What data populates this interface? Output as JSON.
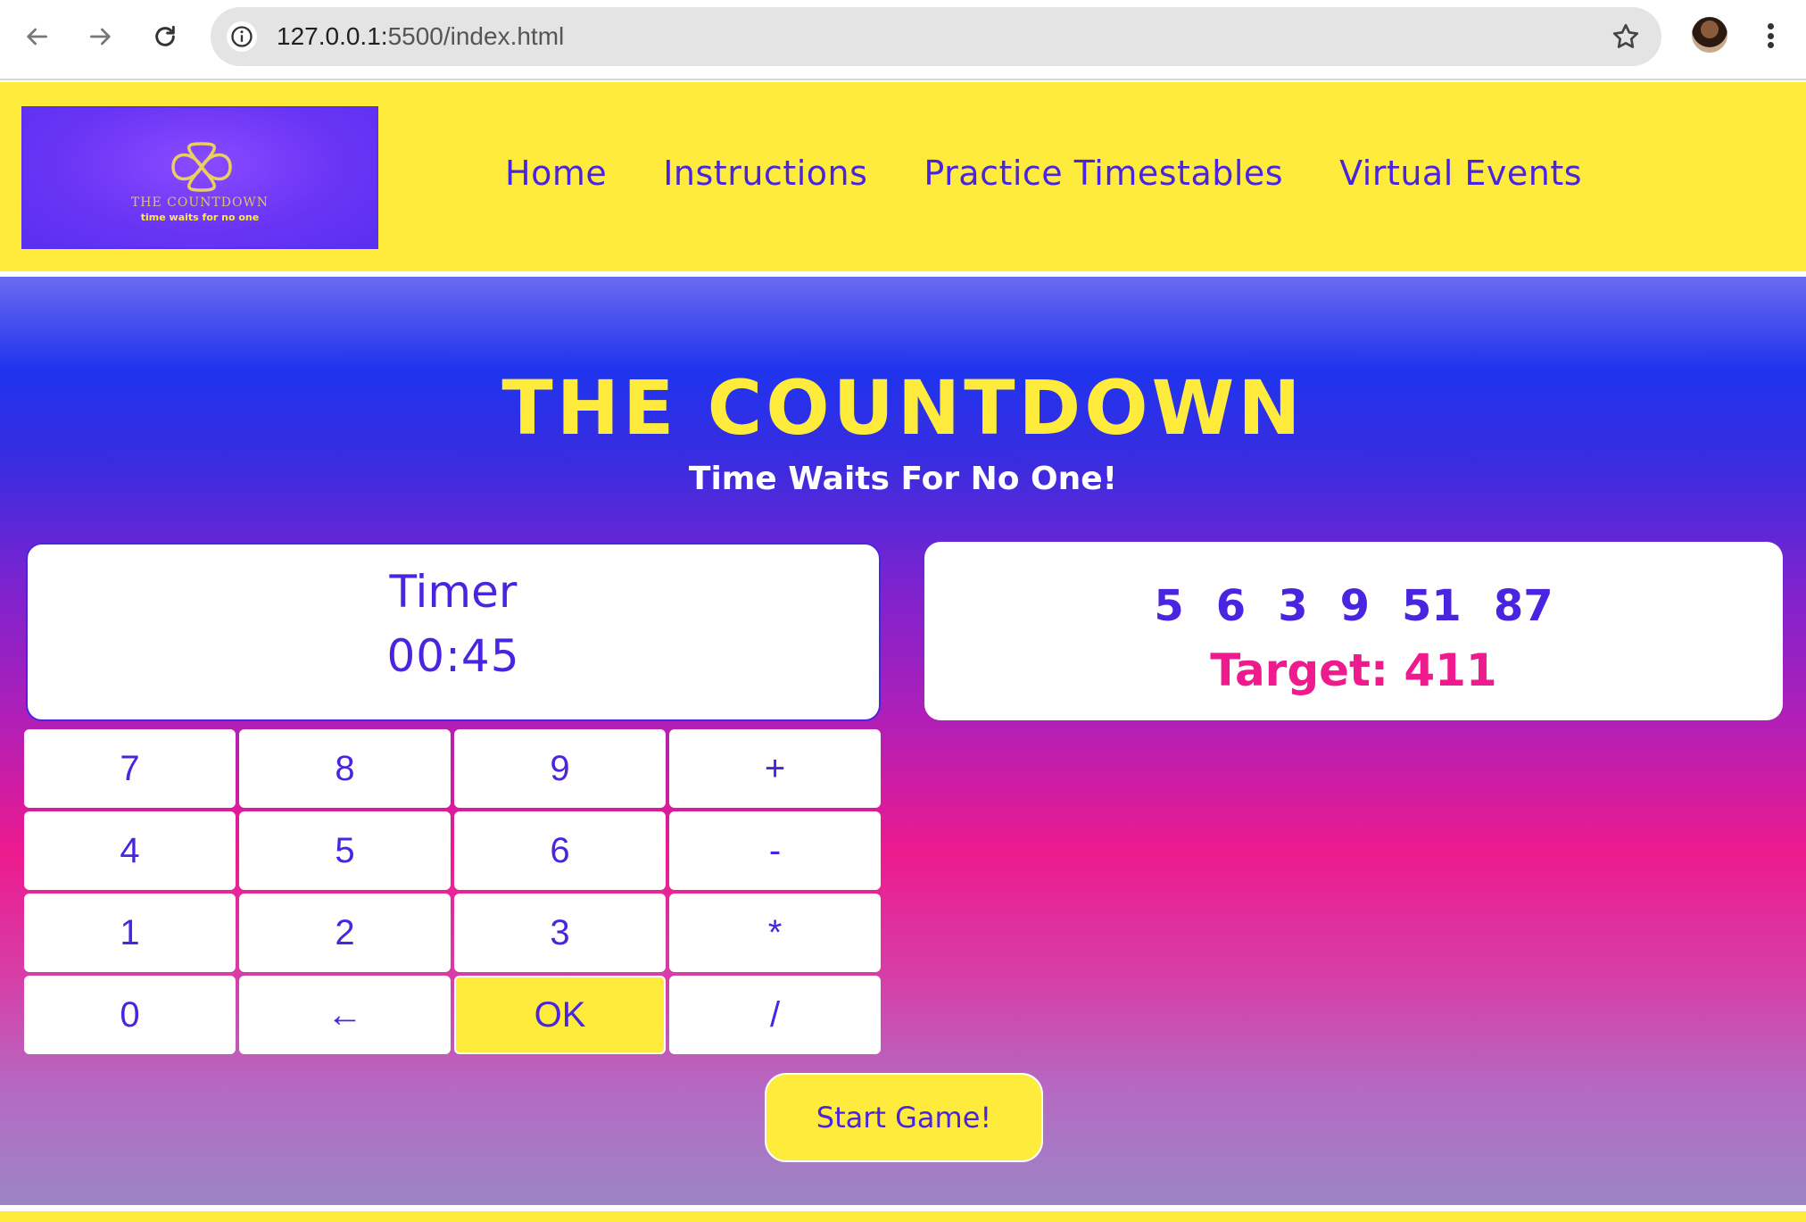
{
  "browser": {
    "url_host": "127.0.0.1:",
    "url_rest": "5500/index.html",
    "icons": [
      "back-arrow-icon",
      "forward-arrow-icon",
      "reload-icon",
      "info-icon",
      "star-icon",
      "profile-avatar",
      "more-menu-icon"
    ]
  },
  "header": {
    "logo_title": "THE COUNTDOWN",
    "logo_subtitle": "time waits for no one",
    "nav": [
      "Home",
      "Instructions",
      "Practice Timestables",
      "Virtual Events"
    ]
  },
  "main": {
    "title": "THE COUNTDOWN",
    "subtitle": "Time Waits For No One!",
    "timer": {
      "label": "Timer",
      "value": "00:45"
    },
    "numbers": [
      "5",
      "6",
      "3",
      "9",
      "51",
      "87"
    ],
    "target": "Target: 411",
    "keypad": [
      [
        "7",
        "8",
        "9",
        "+"
      ],
      [
        "4",
        "5",
        "6",
        "-"
      ],
      [
        "1",
        "2",
        "3",
        "*"
      ],
      [
        "0",
        "←",
        "OK",
        "/"
      ]
    ],
    "start_button": "Start Game!"
  },
  "colors": {
    "accent_yellow": "#ffeb3b",
    "primary_purple": "#4a25e0",
    "target_pink": "#ee1a8e"
  }
}
